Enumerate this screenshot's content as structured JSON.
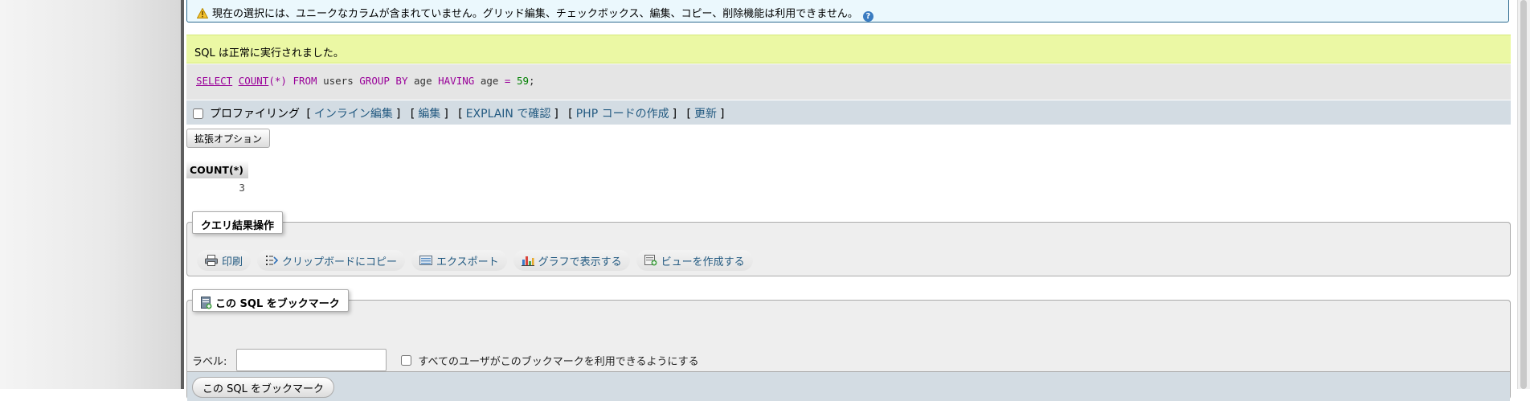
{
  "notice": {
    "text": "現在の選択には、ユニークなカラムが含まれていません。グリッド編集、チェックボックス、編集、コピー、削除機能は利用できません。"
  },
  "success": {
    "text": "SQL は正常に実行されました。"
  },
  "sql": {
    "select": "SELECT",
    "count_fn": "COUNT",
    "open": "(",
    "star": "*",
    "close": ")",
    "from": "FROM",
    "table": "users",
    "group_by": "GROUP BY",
    "col1": "age",
    "having": "HAVING",
    "col2": "age",
    "eq": "=",
    "value": "59",
    "semicolon": ";"
  },
  "profiling": {
    "label": "プロファイリング",
    "links": [
      "インライン編集",
      "編集",
      "EXPLAIN で確認",
      "PHP コードの作成",
      "更新"
    ],
    "open_bracket": "[",
    "close_bracket": "]"
  },
  "extended_options": {
    "label": "拡張オプション"
  },
  "result": {
    "header": "COUNT(*)",
    "value": "3"
  },
  "query_ops": {
    "legend": "クエリ結果操作",
    "print": "印刷",
    "copy": "クリップボードにコピー",
    "export": "エクスポート",
    "chart": "グラフで表示する",
    "create_view": "ビューを作成する"
  },
  "bookmark": {
    "legend": "この SQL をブックマーク",
    "label": "ラベル:",
    "label_value": "",
    "share_label": "すべてのユーザがこのブックマークを利用できるようにする",
    "submit": "この SQL をブックマーク"
  },
  "icons": {
    "warning": "warning-icon",
    "help": "help-icon",
    "print": "print-icon",
    "copy": "copy-icon",
    "export": "export-icon",
    "chart": "chart-icon",
    "view": "view-icon",
    "bookmark": "bookmark-icon"
  },
  "colors": {
    "link": "#235a81",
    "success_bg": "#ebf8a4",
    "notice_bg": "#ebf8fd",
    "keyword": "#990099",
    "number": "#008000"
  }
}
